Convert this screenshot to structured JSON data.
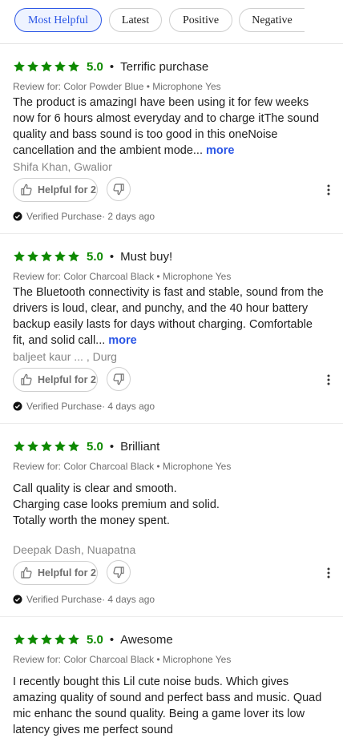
{
  "filters": [
    {
      "label": "Most Helpful",
      "active": true
    },
    {
      "label": "Latest",
      "active": false
    },
    {
      "label": "Positive",
      "active": false
    },
    {
      "label": "Negative",
      "active": false
    }
  ],
  "reviews": [
    {
      "stars": 5,
      "score": "5.0",
      "title": "Terrific purchase",
      "variant": "Review for: Color Powder Blue • Microphone Yes",
      "body_lines": [
        "The product is amazingI have been using it for few weeks",
        "now for 6 hours almost everyday and to charge itThe sound",
        "quality and bass sound is too good in this oneNoise",
        "cancellation and the ambient mode..."
      ],
      "more": "more",
      "author": "Shifa Khan, Gwalior",
      "helpful": "Helpful for 2",
      "verified": "Verified Purchase",
      "age": "· 2 days ago"
    },
    {
      "stars": 5,
      "score": "5.0",
      "title": "Must buy!",
      "variant": "Review for: Color Charcoal Black • Microphone Yes",
      "body_lines": [
        "The Bluetooth connectivity is fast and stable, sound from the",
        "drivers is loud, clear, and punchy, and the 40 hour battery",
        "backup easily lasts for days without charging. Comfortable",
        "fit, and solid call..."
      ],
      "more": "more",
      "author": "baljeet kaur ... , Durg",
      "helpful": "Helpful for 2",
      "verified": "Verified Purchase",
      "age": "· 4 days ago"
    },
    {
      "stars": 5,
      "score": "5.0",
      "title": "Brilliant",
      "variant": "Review for: Color Charcoal Black • Microphone Yes",
      "body_lines": [
        "Call quality is clear and smooth.",
        "Charging case looks premium and solid.",
        "Totally worth the money spent."
      ],
      "more": "",
      "author": "Deepak Dash, Nuapatna",
      "helpful": "Helpful for 2",
      "verified": "Verified Purchase",
      "age": "· 4 days ago"
    },
    {
      "stars": 5,
      "score": "5.0",
      "title": "Awesome",
      "variant": "Review for: Color Charcoal Black • Microphone Yes",
      "body_lines": [
        "I recently bought this Lil cute noise buds. Which gives",
        "amazing quality of sound and perfect bass and music. Quad",
        "mic enhanc the sound quality. Being a game lover its low",
        "latency gives me perfect sound"
      ],
      "more": ""
    }
  ],
  "colors": {
    "star": "#0e8a00",
    "accent": "#2a55e5"
  },
  "icons": {
    "star": "star-icon",
    "thumbs_up": "thumbs-up-icon",
    "thumbs_down": "thumbs-down-icon",
    "more": "more-vertical-icon",
    "verified": "check-circle-icon"
  }
}
